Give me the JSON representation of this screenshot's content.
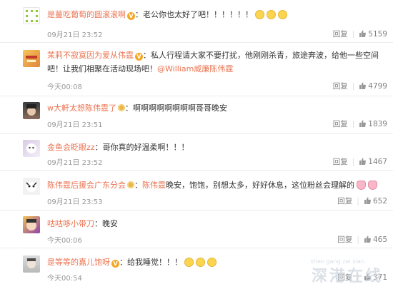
{
  "comments": [
    {
      "user": "是蔓吃葡萄的圆滚滚啊",
      "text": "：老公你也太好了吧！！！！！！",
      "time": "09月21日 23:52",
      "reply": "回复",
      "likes": "5159"
    },
    {
      "user": "茉莉不寂寞因为爱从伟霆",
      "text": "：私人行程请大家不要打扰，他刚刚杀青，旅途奔波，给他一些空间吧！让我们相聚在活动现场吧！",
      "mention": "@William威廉陈伟霆",
      "time": "今天00:08",
      "reply": "回复",
      "likes": "4799"
    },
    {
      "user": "w大軒太想陈伟霆了",
      "text": "：啊啊啊啊啊啊啊啊哥哥晚安",
      "time": "09月21日 23:51",
      "reply": "回复",
      "likes": "1839"
    },
    {
      "user": "金鱼会眨眼zz",
      "text": "：哥你真的好温柔啊！！！",
      "time": "09月21日 23:52",
      "reply": "回复",
      "likes": "1467"
    },
    {
      "user": "陈伟霆后援会广东分会",
      "text_prefix": "：",
      "mention": "陈伟霆",
      "text": "晚安，饱饱，别想太多，好好休息，这位粉丝会理解的",
      "time": "09月21日 23:53",
      "reply": "回复",
      "likes": "652"
    },
    {
      "user": "咕咕哆小带刀",
      "text": "：晚安",
      "time": "今天00:06",
      "reply": "回复",
      "likes": "465"
    },
    {
      "user": "是等等的嘉儿饱呀",
      "text": "：给我睡觉！！！",
      "time": "今天00:54",
      "reply": "回复",
      "likes": "371"
    }
  ],
  "watermark": "深港在线",
  "watermark_sub": "shen gang zai xian"
}
